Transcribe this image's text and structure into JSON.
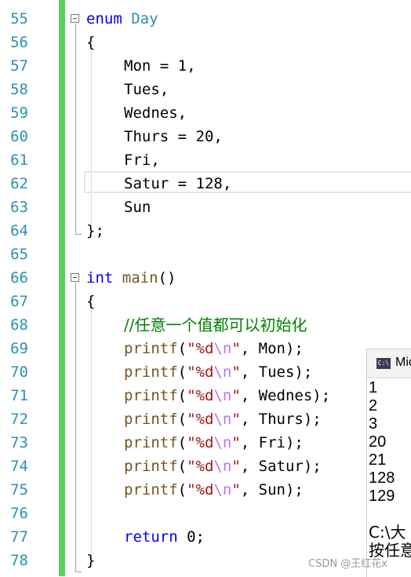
{
  "editor": {
    "line_numbers": [
      "55",
      "56",
      "57",
      "58",
      "59",
      "60",
      "61",
      "62",
      "63",
      "64",
      "65",
      "66",
      "67",
      "68",
      "69",
      "70",
      "71",
      "72",
      "73",
      "74",
      "75",
      "76",
      "77",
      "78"
    ],
    "lines": {
      "l55": {
        "kw": "enum",
        "name": "Day"
      },
      "l56": "{",
      "l57": "Mon = 1,",
      "l58": "Tues,",
      "l59": "Wednes,",
      "l60": "Thurs = 20,",
      "l61": "Fri,",
      "l62": "Satur = 128,",
      "l63": "Sun",
      "l64": "};",
      "l66": {
        "kw": "int",
        "fn": "main",
        "rest": "()"
      },
      "l67": "{",
      "l68": "//任意一个值都可以初始化",
      "printf_fn": "printf",
      "open": "(",
      "fmt_a": "\"%d",
      "escape": "\\n",
      "fmt_b": "\"",
      "args": [
        ", Mon);",
        ", Tues);",
        ", Wednes);",
        ", Thurs);",
        ", Fri);",
        ", Satur);",
        ", Sun);"
      ],
      "l77": {
        "kw": "return",
        "rest": " 0;"
      },
      "l78": "}"
    }
  },
  "console": {
    "title": "Mic",
    "icon": "console-app-icon",
    "output": [
      "1",
      "2",
      "3",
      "20",
      "21",
      "128",
      "129"
    ],
    "prompt_line1": "C:\\大",
    "prompt_line2": "按任意"
  },
  "watermark": "CSDN @王红花x"
}
